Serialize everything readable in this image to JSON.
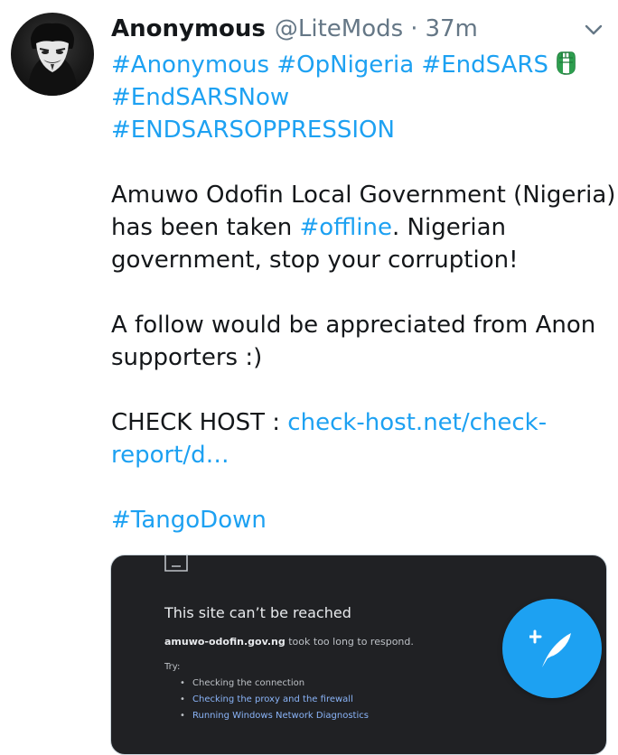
{
  "tweet": {
    "display_name": "Anonymous",
    "handle": "@LiteMods",
    "separator": "·",
    "time": "37m",
    "hashtags_line1": [
      "#Anonymous",
      "#OpNigeria",
      "#EndSARS"
    ],
    "hashtag_line2": "#EndSARSNow",
    "hashtag_line3": "#ENDSARSOPPRESSION",
    "para1_line1": "Amuwo Odofin Local Government (Nigeria)",
    "para1_line2_pre": "has been taken ",
    "para1_line2_tag": "#offline",
    "para1_line2_post": ". Nigerian",
    "para1_line3": "government, stop your corruption!",
    "para2_line1": "A follow would be appreciated from Anon",
    "para2_line2": "supporters :)",
    "check_host_label": "CHECK HOST : ",
    "check_host_link_1": "check-host.net/check-",
    "check_host_link_2": "report/d…",
    "tango_tag": "#TangoDown"
  },
  "media": {
    "title": "This site can’t be reached",
    "host": "amuwo-odofin.gov.ng",
    "detail": " took too long to respond.",
    "try_label": "Try:",
    "try_items": [
      "Checking the connection",
      "Checking the proxy and the firewall",
      "Running Windows Network Diagnostics"
    ]
  },
  "icons": {
    "avatar": "anonymous-mask-avatar",
    "menu": "chevron-down-icon",
    "emoji": "raised-fist-emoji",
    "error": "sad-page-icon",
    "compose": "compose-tweet-icon"
  },
  "colors": {
    "accent": "#1da1f2",
    "text": "#14171a",
    "secondary": "#657786",
    "media_bg": "#202124"
  }
}
